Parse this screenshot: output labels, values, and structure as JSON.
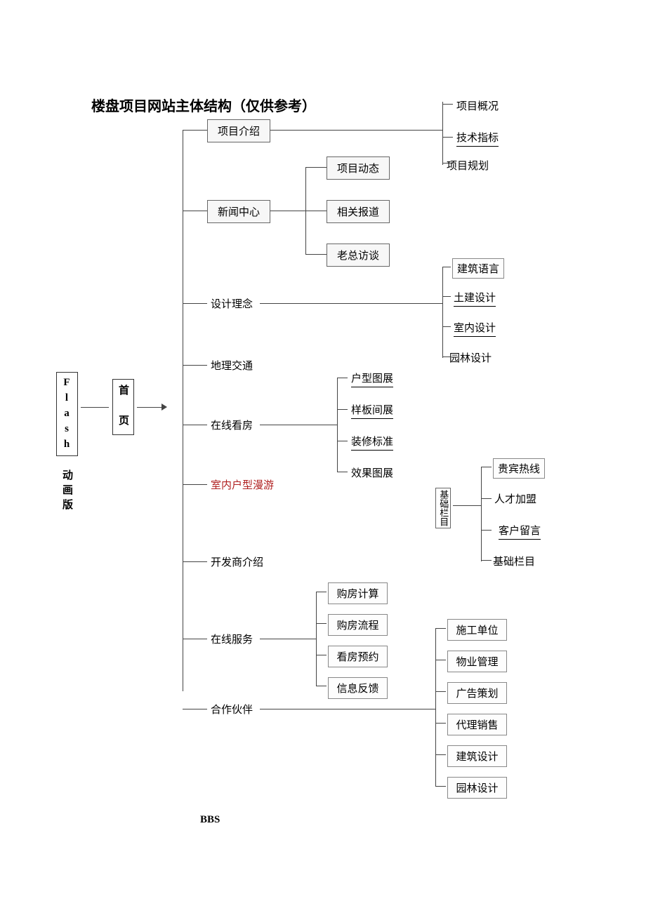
{
  "title": "楼盘项目网站主体结构（仅供参考）",
  "root": {
    "flash": "Flash 动画版",
    "home": "首\n页"
  },
  "level1": {
    "project_intro": "项目介绍",
    "news_center": "新闻中心",
    "design_concept": "设计理念",
    "geo_traffic": "地理交通",
    "online_view": "在线看房",
    "indoor_roam": "室内户型漫游",
    "developer": "开发商介绍",
    "online_service": "在线服务",
    "partners": "合作伙伴",
    "bbs": "BBS"
  },
  "project_intro_children": {
    "overview": "项目概况",
    "tech_index": "技术指标",
    "planning": "项目规划"
  },
  "news_children": {
    "dynamics": "项目动态",
    "reports": "相关报道",
    "interview": "老总访谈"
  },
  "design_children": {
    "arch_lang": "建筑语言",
    "civil": "土建设计",
    "interior": "室内设计",
    "landscape": "园林设计"
  },
  "view_children": {
    "floorplan": "户型图展",
    "showroom": "样板间展",
    "decoration": "装修标准",
    "rendering": "效果图展"
  },
  "base_column_label": "基础栏目",
  "base_column_children": {
    "hotline": "贵宾热线",
    "hr": "人才加盟",
    "guestbook": "客户留言",
    "base": "基础栏目"
  },
  "service_children": {
    "calc": "购房计算",
    "process": "购房流程",
    "appoint": "看房预约",
    "feedback": "信息反馈"
  },
  "partner_children": {
    "construction": "施工单位",
    "property": "物业管理",
    "ad": "广告策划",
    "agent": "代理销售",
    "arch_design": "建筑设计",
    "landscape_design": "园林设计"
  }
}
